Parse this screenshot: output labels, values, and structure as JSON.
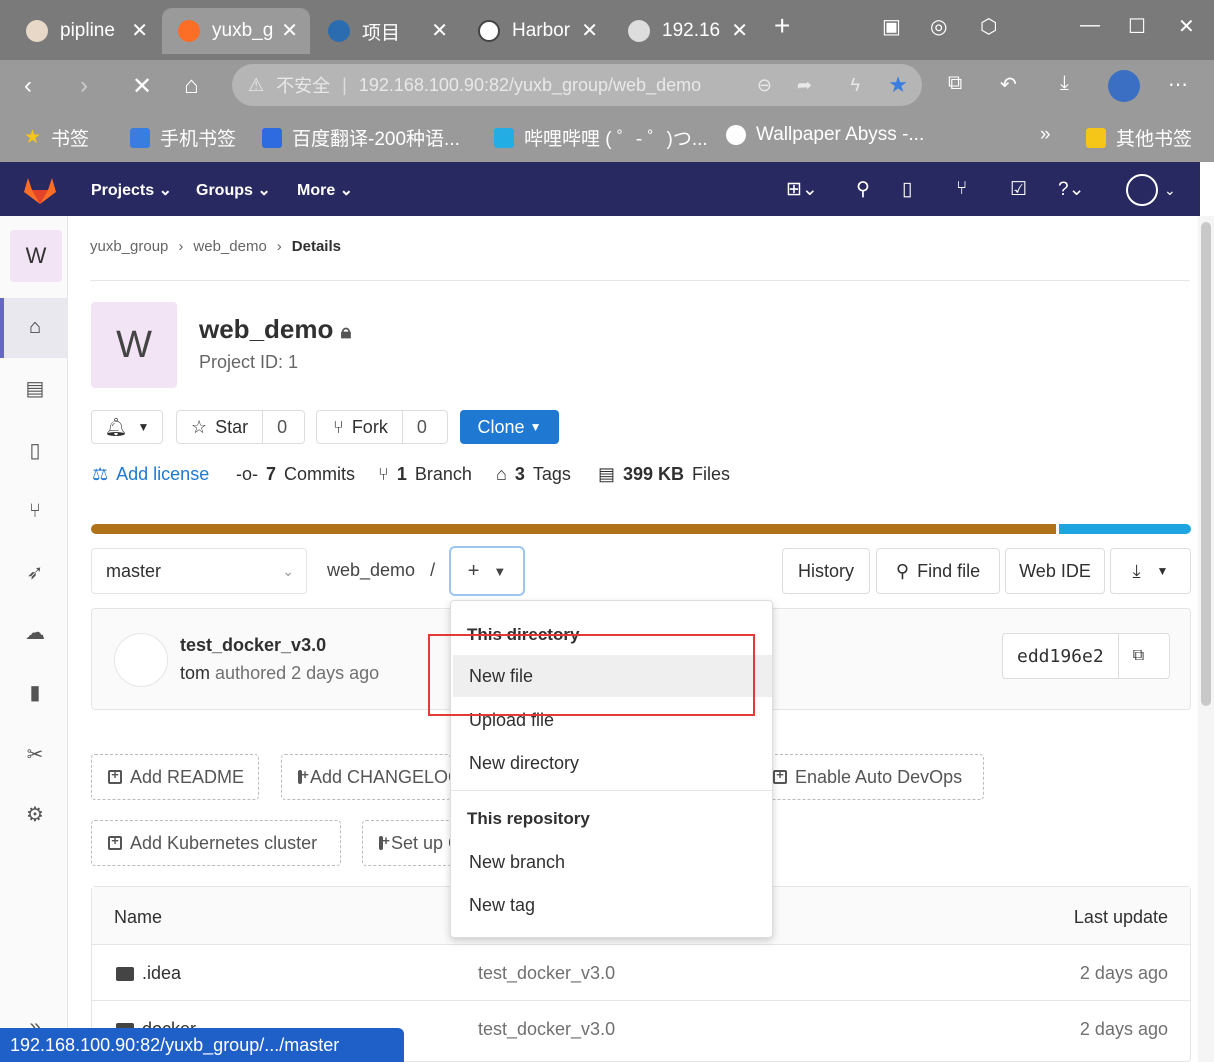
{
  "browser": {
    "tabs": [
      {
        "label": "pipline"
      },
      {
        "label": "yuxb_g"
      },
      {
        "label": "项目"
      },
      {
        "label": "Harbor"
      },
      {
        "label": "192.16"
      }
    ],
    "address": {
      "security": "不安全",
      "url": "192.168.100.90:82/yuxb_group/web_demo"
    },
    "bookmarks": [
      {
        "label": "书签"
      },
      {
        "label": "手机书签"
      },
      {
        "label": "百度翻译-200种语..."
      },
      {
        "label": "哔哩哔哩 ( ゜- ゜)つ..."
      },
      {
        "label": "Wallpaper Abyss -..."
      },
      {
        "label": "其他书签"
      }
    ],
    "overflow": "»",
    "status_url": "192.168.100.90:82/yuxb_group/.../master"
  },
  "gitlab_nav": {
    "projects": "Projects",
    "groups": "Groups",
    "more": "More"
  },
  "sidebar": {
    "project_letter": "W"
  },
  "breadcrumb": {
    "group": "yuxb_group",
    "project": "web_demo",
    "current": "Details"
  },
  "project": {
    "avatar_letter": "W",
    "name": "web_demo",
    "id_text": "Project ID: 1"
  },
  "actions": {
    "star": "Star",
    "star_count": "0",
    "fork": "Fork",
    "fork_count": "0",
    "clone": "Clone"
  },
  "stats": {
    "license": "Add license",
    "commits_n": "7",
    "commits": "Commits",
    "branch_n": "1",
    "branch": "Branch",
    "tags_n": "3",
    "tags": "Tags",
    "files_n": "399 KB",
    "files": "Files"
  },
  "languages": [
    {
      "share": 0.88,
      "color": "#b07219"
    },
    {
      "share": 0.12,
      "color": "#1ea5e0"
    }
  ],
  "repo": {
    "ref": "master",
    "path": "web_demo",
    "path_sep": "/",
    "history": "History",
    "find_file": "Find file",
    "web_ide": "Web IDE"
  },
  "commit": {
    "title": "test_docker_v3.0",
    "author": "tom",
    "meta": "authored 2 days ago",
    "sha": "edd196e2"
  },
  "quick_actions": {
    "readme": "Add README",
    "changelog": "Add CHANGELOG",
    "devops": "Enable Auto DevOps",
    "k8s": "Add Kubernetes cluster",
    "setup": "Set up CI/CD"
  },
  "dropdown": {
    "dir_header": "This directory",
    "new_file": "New file",
    "upload_file": "Upload file",
    "new_directory": "New directory",
    "repo_header": "This repository",
    "new_branch": "New branch",
    "new_tag": "New tag"
  },
  "table": {
    "col_name": "Name",
    "col_update": "Last update",
    "rows": [
      {
        "name": ".idea",
        "commit": "test_docker_v3.0",
        "updated": "2 days ago"
      },
      {
        "name": "docker",
        "commit": "test_docker_v3.0",
        "updated": "2 days ago"
      }
    ]
  }
}
